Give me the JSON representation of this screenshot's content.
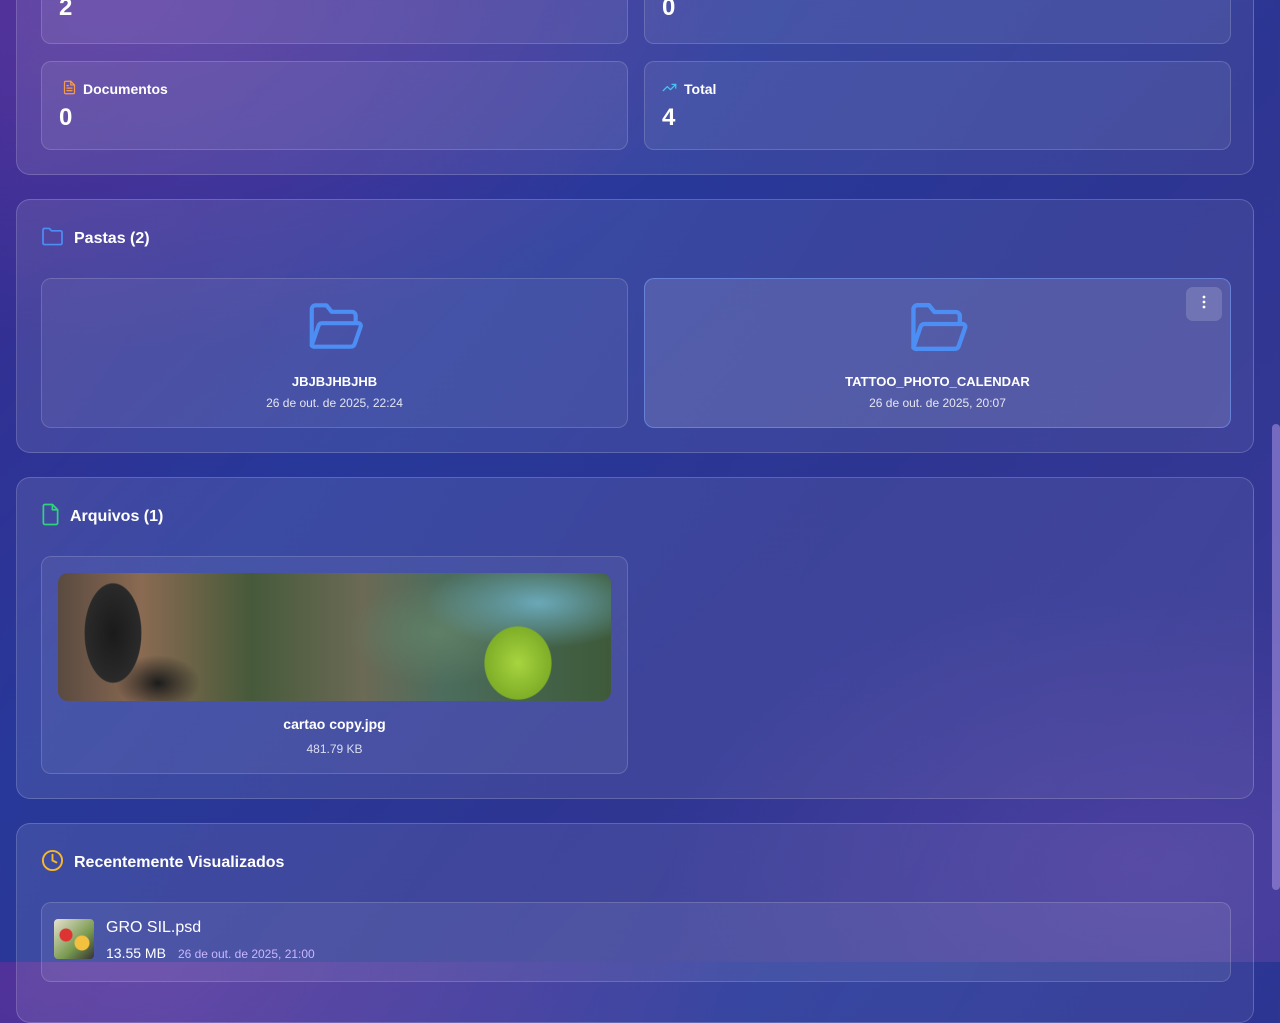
{
  "stats": {
    "top_left_value": "2",
    "top_right_value": "0",
    "documents": {
      "label": "Documentos",
      "value": "0",
      "icon": "document-icon",
      "color": "#f59a4a"
    },
    "total": {
      "label": "Total",
      "value": "4",
      "icon": "trending-up-icon",
      "color": "#3ec8f0"
    }
  },
  "folders": {
    "title": "Pastas (2)",
    "icon": "folder-icon",
    "items": [
      {
        "name": "JBJBJHBJHB",
        "date": "26 de out. de 2025, 22:24"
      },
      {
        "name": "TATTOO_PHOTO_CALENDAR",
        "date": "26 de out. de 2025, 20:07"
      }
    ]
  },
  "files": {
    "title": "Arquivos (1)",
    "icon": "file-icon",
    "items": [
      {
        "name": "cartao copy.jpg",
        "size": "481.79 KB"
      }
    ]
  },
  "recent": {
    "title": "Recentemente Visualizados",
    "icon": "clock-icon",
    "items": [
      {
        "name": "GRO SIL.psd",
        "size": "13.55 MB",
        "date": "26 de out. de 2025, 21:00"
      }
    ]
  },
  "colors": {
    "accent_blue": "#4d8ef5",
    "file_green": "#2ed47a",
    "clock_yellow": "#f5b82e"
  }
}
